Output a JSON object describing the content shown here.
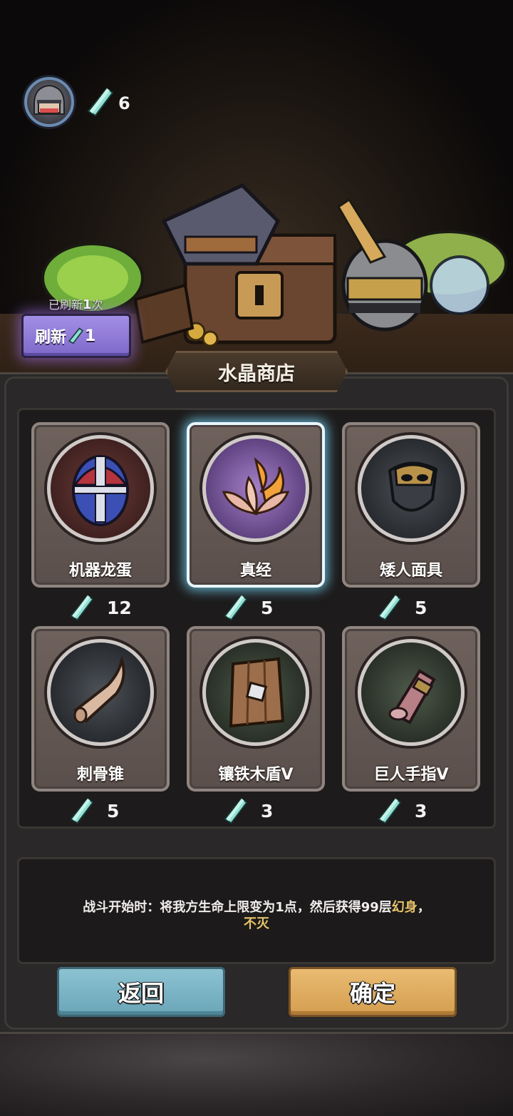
{
  "player": {
    "crystal_count": "6"
  },
  "refresh": {
    "note_prefix": "已刷新",
    "note_count": "1",
    "note_suffix": "次",
    "button_label": "刷新",
    "cost": "1"
  },
  "shop": {
    "title": "水晶商店",
    "items": [
      {
        "name": "机器龙蛋",
        "price": "12",
        "icon": "mech-dragon-egg-icon"
      },
      {
        "name": "真经",
        "price": "5",
        "icon": "flame-lotus-icon"
      },
      {
        "name": "矮人面具",
        "price": "5",
        "icon": "dwarf-mask-icon"
      },
      {
        "name": "刺骨锥",
        "price": "5",
        "icon": "bone-spike-icon"
      },
      {
        "name": "镶铁木盾V",
        "price": "3",
        "icon": "iron-wood-shield-icon"
      },
      {
        "name": "巨人手指V",
        "price": "3",
        "icon": "giant-finger-icon"
      }
    ],
    "selected_index": 1
  },
  "description": {
    "part1": "战斗开始时：将我方生命上限变为1点，然后获得99层",
    "highlight1": "幻身",
    "part2": "，",
    "line2": "不灭"
  },
  "buttons": {
    "back": "返回",
    "confirm": "确定"
  },
  "colors": {
    "crystal": "#7fd6c9",
    "highlight_text": "#e7c56a",
    "selected_glow": "#78dcff",
    "back_button": "#7fb7c8",
    "confirm_button": "#e2ad61",
    "refresh_button": "#9582da"
  }
}
